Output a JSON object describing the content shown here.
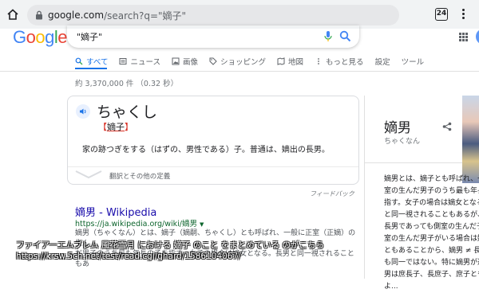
{
  "browser": {
    "url_host": "google.com",
    "url_path": "/search?q=\"嫡子\"",
    "tab_count": "24"
  },
  "search": {
    "query": "\"嫡子\""
  },
  "tabs": [
    {
      "label": "すべて",
      "icon": "search-icon"
    },
    {
      "label": "ニュース",
      "icon": "news-icon"
    },
    {
      "label": "画像",
      "icon": "image-icon"
    },
    {
      "label": "ショッピング",
      "icon": "tag-icon"
    },
    {
      "label": "地図",
      "icon": "map-icon"
    },
    {
      "label": "もっと見る",
      "icon": "more-icon"
    },
    {
      "label": "設定",
      "icon": ""
    },
    {
      "label": "ツール",
      "icon": ""
    }
  ],
  "stats": "約 3,370,000 件 （0.32 秒）",
  "dictionary": {
    "reading": "ちゃくし",
    "kanji_open": "【",
    "kanji": "嫡子",
    "kanji_close": "】",
    "definition": "家の跡つぎをする（はずの、男性である）子。普通は、嫡出の長男。",
    "more": "翻訳とその他の定義",
    "feedback": "フィードバック"
  },
  "result": {
    "title": "嫡男 - Wikipedia",
    "url": "https://ja.wikipedia.org/wiki/嫡男",
    "snippet_1": "嫡男（ちゃくなん）とは、嫡子（嫡嗣、ちゃくし）とも呼ばれ、一般に正室（正嫡）の生ん",
    "snippet_2": "だ男子のうち最も年長の子を指す。女子の場合は嫡女となる。長男と同一視されることもあ"
  },
  "watermark": {
    "line1": "ファイアーエムブレム 風花雪月 における 嫡子 のこと をまとめている のがこちら",
    "line2": "https://krsw.5ch.net/test/read.cgi/ghard/1586104067/"
  },
  "knowledge_panel": {
    "title": "嫡男",
    "subtitle": "ちゃくなん",
    "lines": [
      "嫡男とは、嫡子とも呼ばれ、一般",
      "室の生んだ男子のうち最も年長の",
      "指す。女子の場合は嫡女となる。",
      "と同一視されることもあるが、",
      "長男であっても側室の生んだ子",
      "室の生んだ男子がいる場合は嫡",
      "ともあることから、嫡男 ≠ 長男",
      "も同一ではない。特に嫡男が選",
      "男は庶長子、長庶子、庶子とも",
      "よ..."
    ]
  }
}
